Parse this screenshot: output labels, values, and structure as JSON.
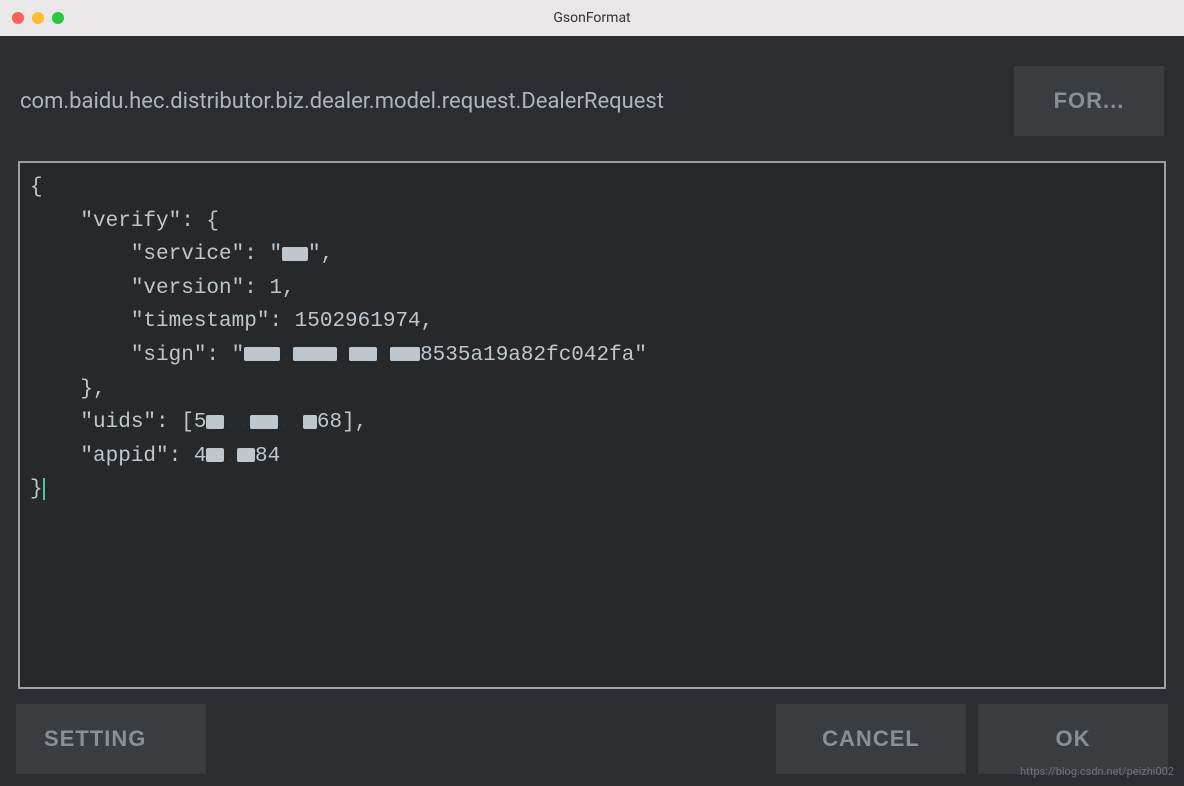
{
  "window": {
    "title": "GsonFormat"
  },
  "header": {
    "class_path": "com.baidu.hec.distributor.biz.dealer.model.request.DealerRequest",
    "format_button": "FOR..."
  },
  "json_content": {
    "line1": "{",
    "line2": "    \"verify\": {",
    "line3_a": "        \"service\": \"",
    "line3_b": "\",",
    "line4": "        \"version\": 1,",
    "line5": "        \"timestamp\": 1502961974,",
    "line6_a": "        \"sign\": \"",
    "line6_b": "8535a19a82fc042fa\"",
    "line7": "    },",
    "line8_a": "    \"uids\": [5",
    "line8_b": "68],",
    "line9_a": "    \"appid\": 4",
    "line9_b": "84",
    "line10": "}"
  },
  "buttons": {
    "setting": "SETTING",
    "cancel": "CANCEL",
    "ok": "OK"
  },
  "watermark": "https://blog.csdn.net/peizhi002"
}
